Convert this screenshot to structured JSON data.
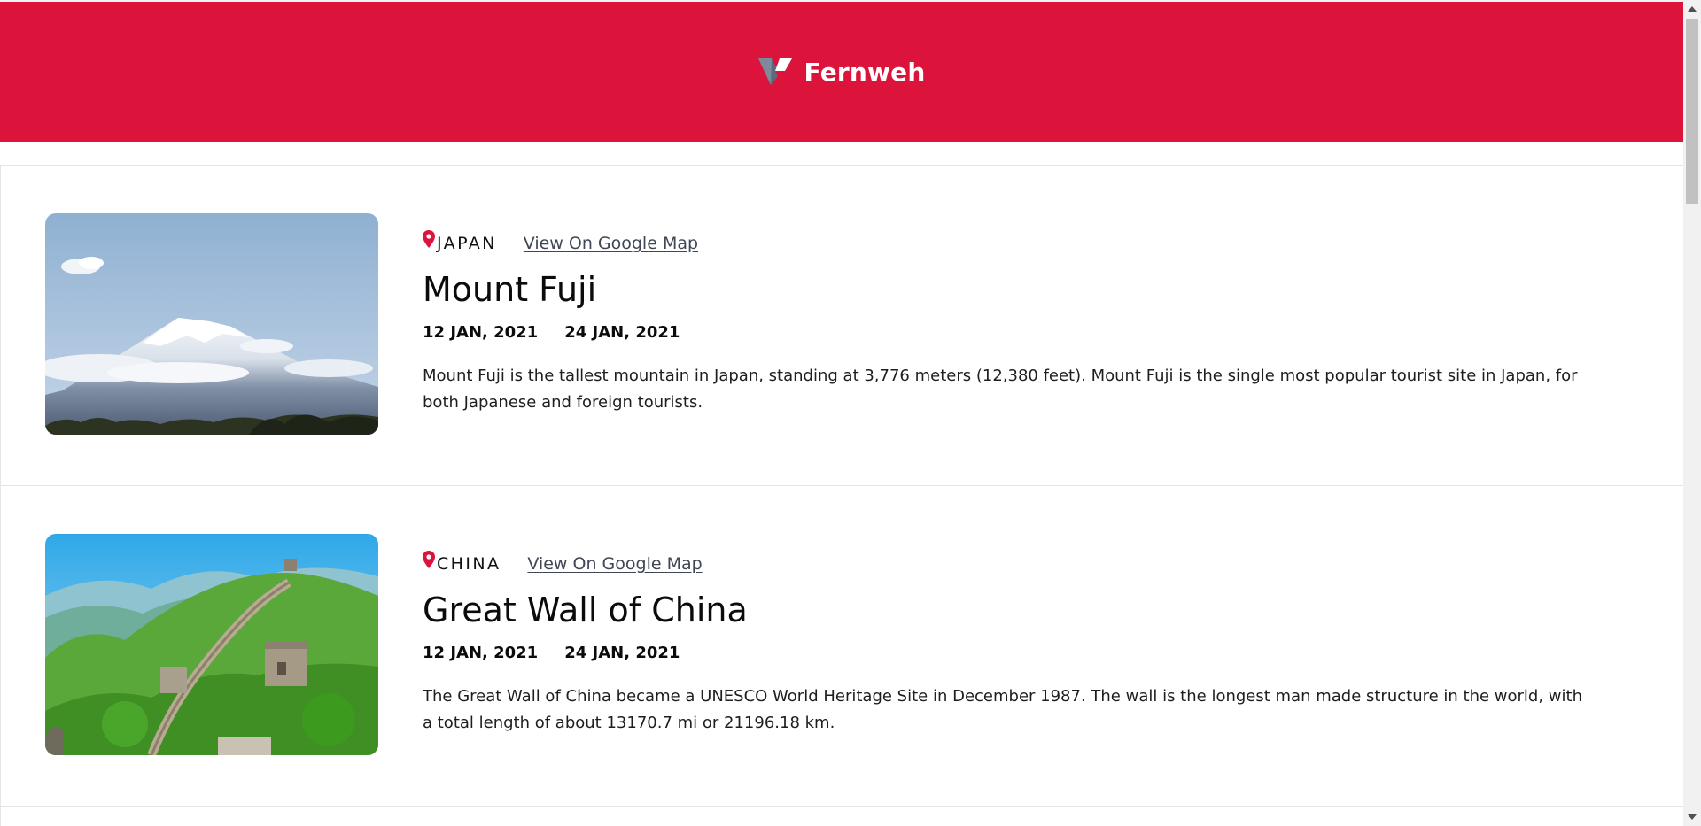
{
  "header": {
    "logo_icon": "fernweh-logo-icon",
    "brand": "Fernweh",
    "background": "#dc143c"
  },
  "entries": [
    {
      "country": "JAPAN",
      "map_link": "View On Google Map",
      "title": "Mount Fuji",
      "start_date": "12 JAN, 2021",
      "end_date": "24 JAN, 2021",
      "description": "Mount Fuji is the tallest mountain in Japan, standing at 3,776 meters (12,380 feet). Mount Fuji is the single most popular tourist site in Japan, for both Japanese and foreign tourists.",
      "image": "mount-fuji-photo"
    },
    {
      "country": "CHINA",
      "map_link": "View On Google Map",
      "title": "Great Wall of China",
      "start_date": "12 JAN, 2021",
      "end_date": "24 JAN, 2021",
      "description": "The Great Wall of China became a UNESCO World Heritage Site in December 1987. The wall is the longest man made structure in the world, with a total length of about 13170.7 mi or 21196.18 km.",
      "image": "great-wall-photo"
    }
  ],
  "icons": {
    "pin": "location-pin-icon",
    "scroll_up": "chevron-up-icon",
    "scroll_down": "chevron-down-icon"
  },
  "colors": {
    "accent": "#dc143c",
    "link": "#3f4656"
  }
}
